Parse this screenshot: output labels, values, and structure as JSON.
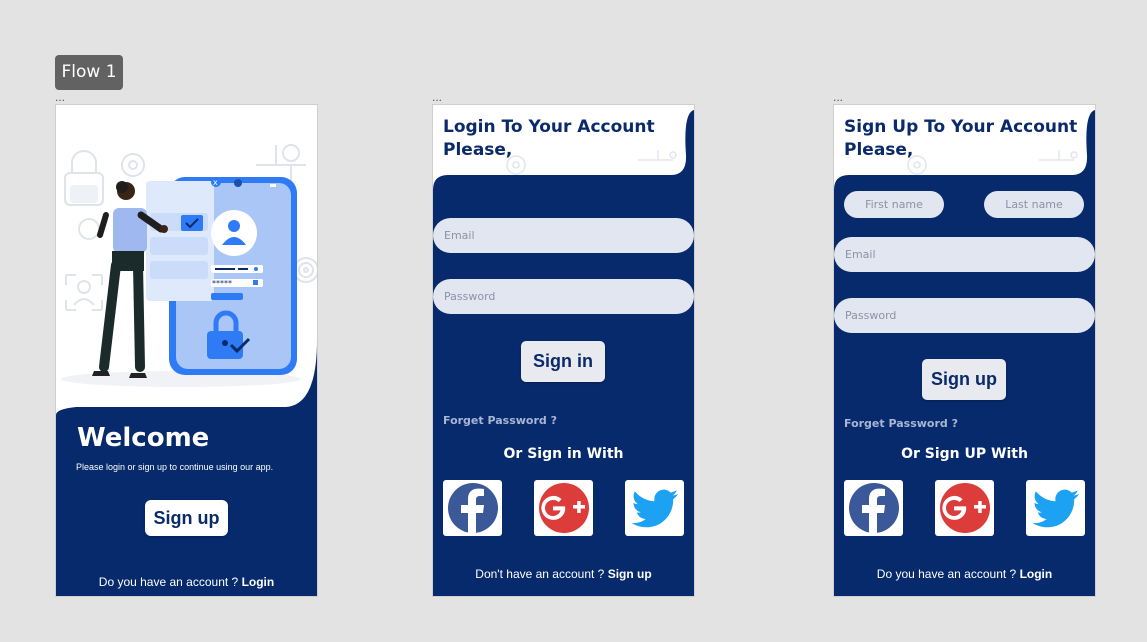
{
  "flow_label": "Flow 1",
  "frame_marker": "...",
  "welcome": {
    "title": "Welcome",
    "subtitle": "Please login or sign up to continue using our app.",
    "signup_button": "Sign up",
    "footer_text": "Do you have an account ?",
    "footer_link": "Login",
    "illustration_password": "*****"
  },
  "login": {
    "title_line1": "Login To Your Account",
    "title_line2": "Please,",
    "email_placeholder": "Email",
    "password_placeholder": "Password",
    "signin_button": "Sign in",
    "forgot": "Forget Password ?",
    "or_text": "Or Sign in With",
    "footer_text": "Don't have an account ?",
    "footer_link": "Sign up"
  },
  "signup": {
    "title_line1": "Sign Up To Your Account",
    "title_line2": "Please,",
    "first_name_placeholder": "First name",
    "last_name_placeholder": "Last name",
    "email_placeholder": "Email",
    "password_placeholder": "Password",
    "signup_button": "Sign up",
    "forgot": "Forget Password ?",
    "or_text": "Or Sign UP With",
    "footer_text": "Do you have an account ?",
    "footer_link": "Login"
  },
  "social_icons": [
    "facebook-icon",
    "google-plus-icon",
    "twitter-icon"
  ],
  "colors": {
    "navy": "#062a6b",
    "input_bg": "#e2e6f0",
    "facebook": "#3b5998",
    "google": "#dc3d3b",
    "twitter": "#1da1f2",
    "illustration_blue": "#2f7bf5"
  }
}
